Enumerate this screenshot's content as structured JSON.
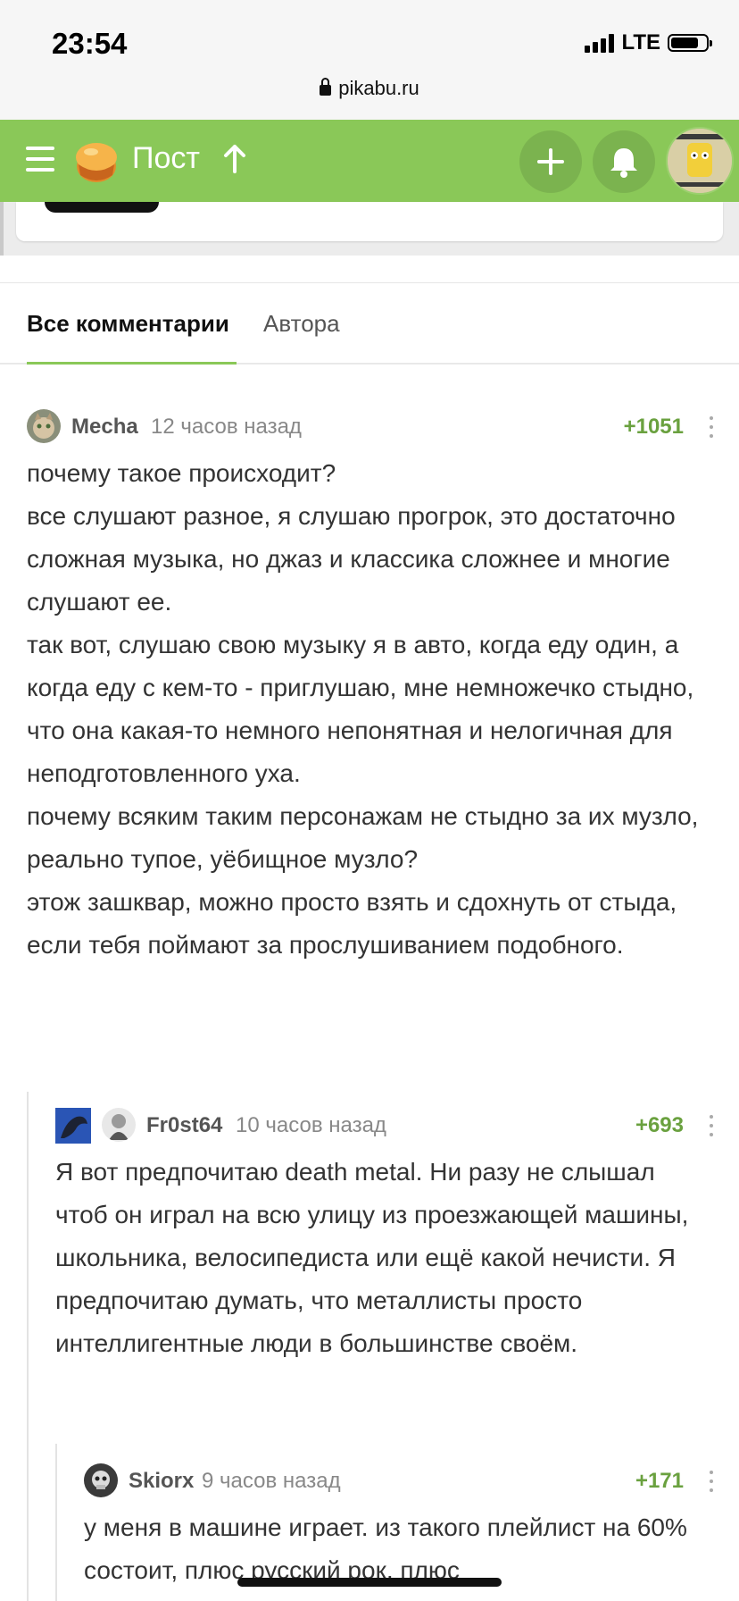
{
  "status": {
    "time": "23:54",
    "network": "LTE",
    "url": "pikabu.ru"
  },
  "header": {
    "title": "Пост"
  },
  "tabs": [
    {
      "label": "Все комментарии"
    },
    {
      "label": "Автора"
    }
  ],
  "comments": [
    {
      "user": "Mecha",
      "time": "12 часов назад",
      "rating": "+1051",
      "text": "почему такое происходит?\nвсе слушают разное, я слушаю прогрок, это достаточно сложная музыка, но джаз и классика сложнее и многие слушают ее.\nтак вот, слушаю свою музыку я в авто, когда еду один, а когда еду с кем-то - приглушаю, мне немножечко стыдно, что она какая-то немного непонятная и нелогичная для неподготовленного уха.\nпочему всяким таким персонажам не стыдно за их музло, реально тупое, уёбищное музло?\nэтож зашквар, можно просто взять и сдохнуть от стыда, если тебя поймают за прослушиванием подобного."
    },
    {
      "user": "Fr0st64",
      "time": "10 часов назад",
      "rating": "+693",
      "text": "Я вот предпочитаю death metal. Ни разу не слышал чтоб он играл на всю улицу из проезжающей машины, школьника, велосипедиста или ещё какой нечисти. Я предпочитаю думать, что металлисты просто интеллигентные люди в большинстве своём."
    },
    {
      "user": "Skiorx",
      "time": "9 часов назад",
      "rating": "+171",
      "text": "у меня в машине играет. из такого плейлист на 60% состоит, плюс русский рок, плюс"
    }
  ],
  "colors": {
    "brand": "#8ac858",
    "rating": "#6aa13f"
  }
}
